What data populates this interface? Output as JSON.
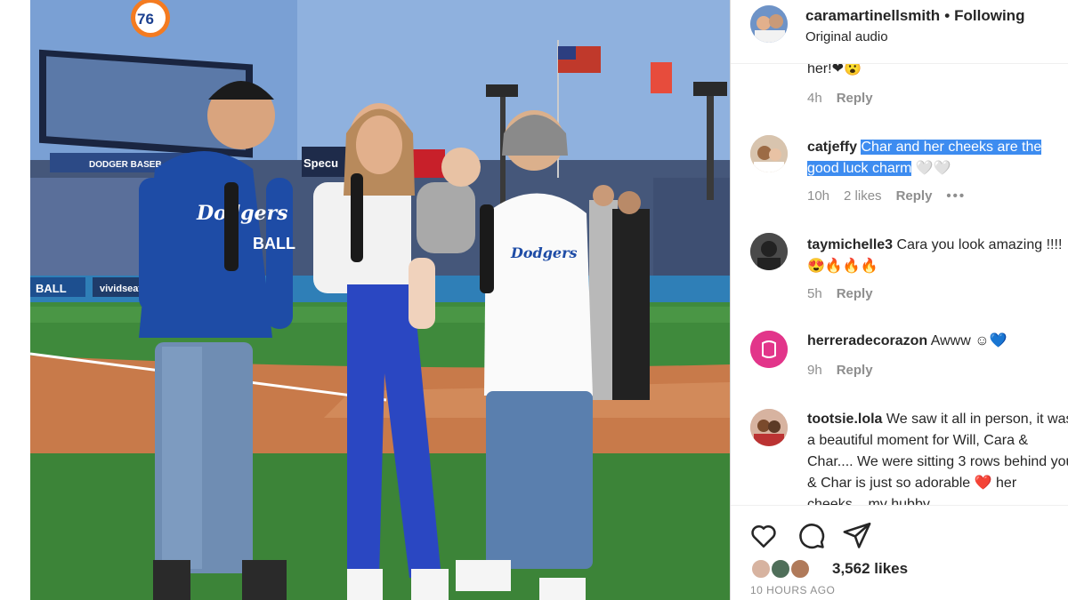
{
  "post": {
    "username": "caramartinellsmith",
    "separator": "•",
    "follow_state": "Following",
    "audio": "Original audio"
  },
  "media": {
    "scoreboard_logo": "76",
    "sponsor_spectrum": "Specu",
    "sign_ball": "BALL",
    "sign_vivid": "vividseats",
    "sign_dodger": "DODGER BASEB",
    "hoodie_line1": "Dodgers",
    "hoodie_line2": "BALL",
    "jersey_text": "Dodgers"
  },
  "comments": [
    {
      "id": "c0",
      "user": "",
      "text": "her!",
      "emojis": "❤😮",
      "time": "4h",
      "likes": "",
      "reply": "Reply"
    },
    {
      "id": "c1",
      "user": "catjeffy",
      "text": "Char and her cheeks are the good luck charm",
      "emojis": "🤍🤍",
      "time": "10h",
      "likes": "2 likes",
      "reply": "Reply",
      "more": "•••",
      "highlighted": true
    },
    {
      "id": "c2",
      "user": "taymichelle3",
      "text": "Cara you look amazing !!!!",
      "emojis": "😍🔥🔥🔥",
      "time": "5h",
      "likes": "",
      "reply": "Reply"
    },
    {
      "id": "c3",
      "user": "herreradecorazon",
      "text": "Awww",
      "emojis": "☺💙",
      "time": "9h",
      "likes": "",
      "reply": "Reply"
    },
    {
      "id": "c4",
      "user": "tootsie.lola",
      "text": "We saw it all in person, it was a beautiful moment for Will, Cara & Char.... We were sitting 3 rows behind you & Char is just so adorable",
      "emojis": "❤️",
      "tail": "her cheeks... my hubby",
      "time": "",
      "likes": "",
      "reply": ""
    }
  ],
  "footer": {
    "likes": "3,562 likes",
    "time_ago": "10 HOURS AGO"
  },
  "icons": {
    "like": "heart-icon",
    "comment": "comment-icon",
    "share": "share-icon"
  },
  "colors": {
    "highlight": "#3d8cf0",
    "text": "#262626",
    "muted": "#8e8e8e"
  }
}
